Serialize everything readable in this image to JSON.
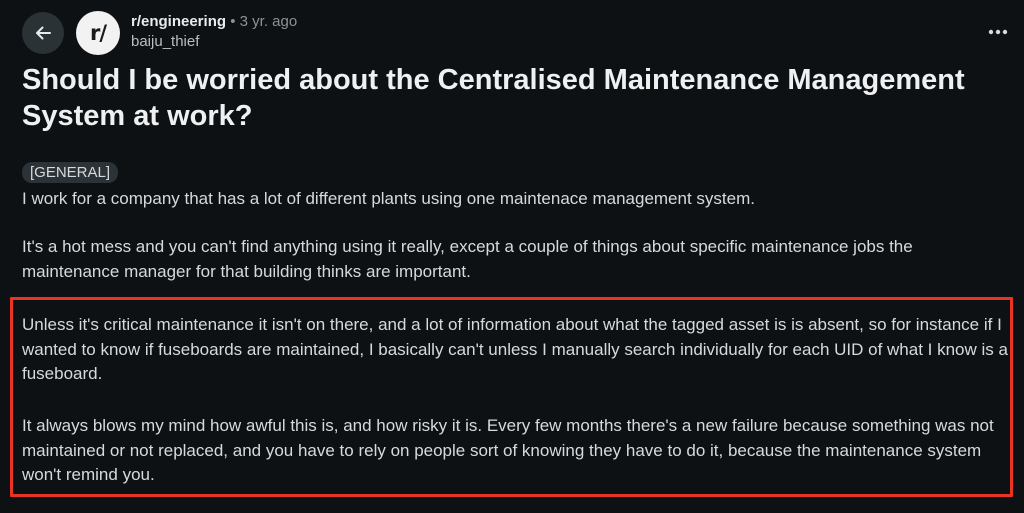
{
  "header": {
    "back_icon": "arrow-left-icon",
    "avatar_text": "r/",
    "subreddit": "r/engineering",
    "separator": "•",
    "age": "3 yr. ago",
    "username": "baiju_thief",
    "more_icon": "ellipsis-horizontal-icon"
  },
  "post": {
    "title": "Should I be worried about the Centralised Maintenance Management System at work?",
    "flair": "[GENERAL]",
    "paragraphs": [
      "I work for a company that has a lot of different plants using one maintenace management system.",
      "It's a hot mess and you can't find anything using it really, except a couple of things about specific maintenance jobs the maintenance manager for that building thinks are important.",
      "Unless it's critical maintenance it isn't on there, and a lot of information about what the tagged asset is is absent, so for instance if I wanted to know if fuseboards are maintained, I basically can't unless I manually search individually for each UID of what I know is a fuseboard.",
      "It always blows my mind how awful this is, and how risky it is. Every few months there's a new failure because something was not maintained or not replaced, and you have to rely on people sort of knowing they have to do it, because the maintenance system won't remind you."
    ]
  },
  "colors": {
    "background": "#0e1113",
    "text": "#d7dadc",
    "highlight_border": "#ea3324",
    "flair_bg": "#2c3338"
  }
}
